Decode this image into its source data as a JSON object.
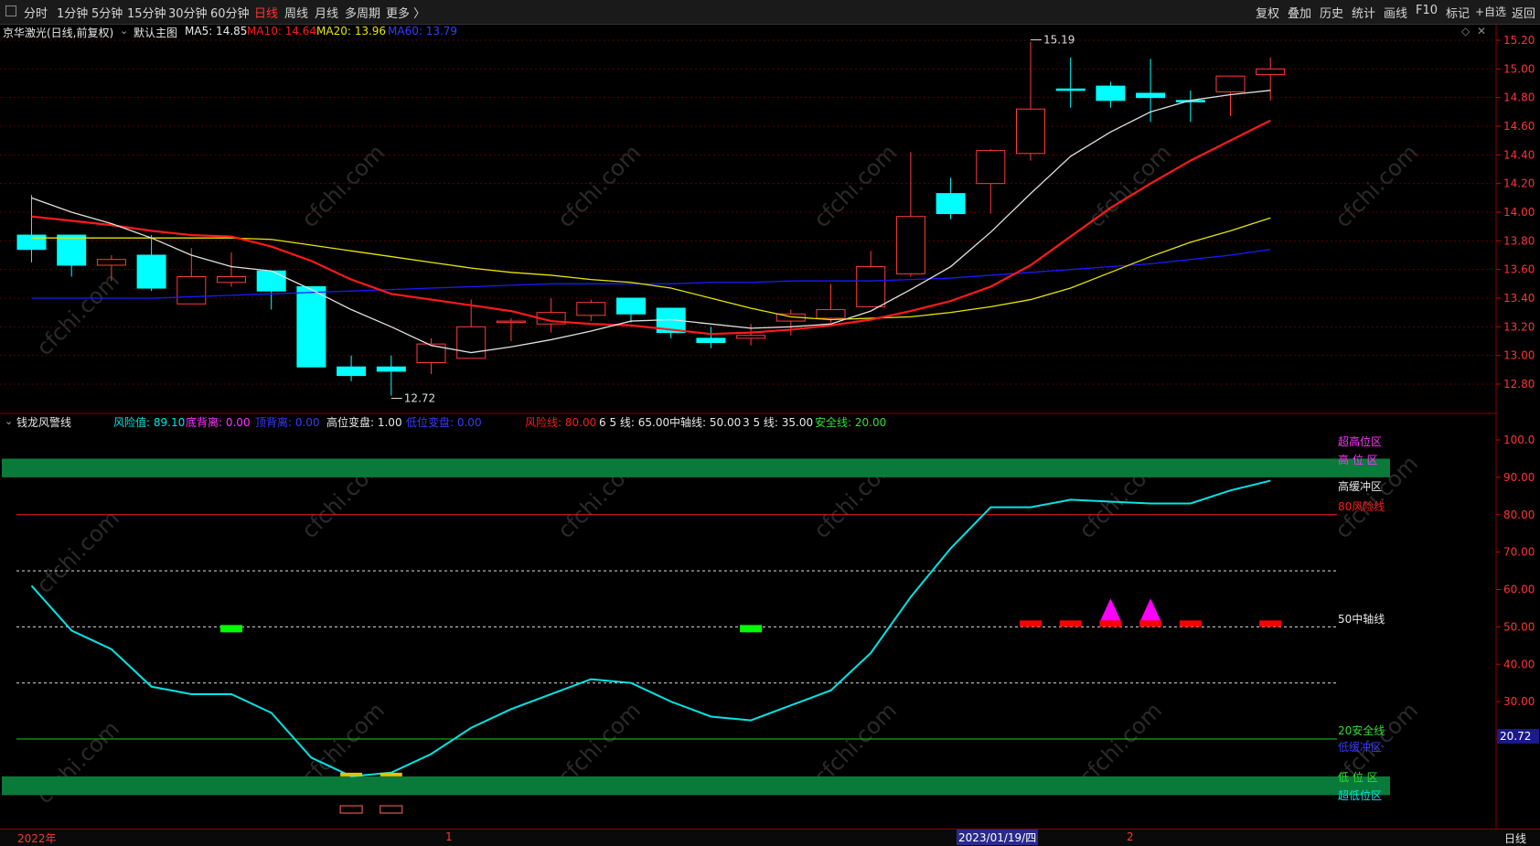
{
  "toolbar": {
    "left": [
      "分时",
      "1分钟",
      "5分钟",
      "15分钟",
      "30分钟",
      "60分钟",
      "日线",
      "周线",
      "月线",
      "多周期",
      "更多 〉"
    ],
    "active": "日线",
    "right": [
      "复权",
      "叠加",
      "历史",
      "统计",
      "画线",
      "F10",
      "+自选",
      "返回"
    ],
    "mark": "标记"
  },
  "main": {
    "stock": "京华激光(日线,前复权)",
    "template": "默认主图",
    "ma5": "MA5: 14.85",
    "ma10": "MA10: 14.64",
    "ma20": "MA20: 13.96",
    "ma60": "MA60: 13.79",
    "high_marker": "15.19",
    "low_marker": "12.72",
    "price_ticks": [
      "15.20",
      "15.00",
      "14.80",
      "14.60",
      "14.40",
      "14.20",
      "14.00",
      "13.80",
      "13.60",
      "13.40",
      "13.20",
      "13.00",
      "12.80"
    ]
  },
  "indicator": {
    "name": "钱龙风警线",
    "fxz": "风险值: 89.10",
    "dbl": "底背离: 0.00",
    "dbl2": "顶背离: 0.00",
    "gwbp": "高位变盘: 1.00",
    "dwbp": "低位变盘: 0.00",
    "fxx": "风险线: 80.00",
    "l65": "6 5 线: 65.00",
    "zzx": "中轴线: 50.00",
    "l35": "3 5 线: 35.00",
    "aqx": "安全线: 20.00",
    "ticks": [
      "100.0",
      "90.00",
      "80.00",
      "70.00",
      "60.00",
      "50.00",
      "40.00",
      "30.00",
      "20.00"
    ],
    "current": "20.72",
    "zones": {
      "super_high": "超高位区",
      "high": "高  位  区",
      "high_buffer": "高缓冲区",
      "risk80": "80风险线",
      "axis50": "50中轴线",
      "safe20": "20安全线",
      "low_buffer": "低缓冲区",
      "low": "低  位  区",
      "super_low": "超低位区"
    }
  },
  "bottom": {
    "year": "2022年",
    "m1": "1",
    "date": "2023/01/19/四",
    "m2": "2",
    "period": "日线"
  },
  "watermark": "cfchi.com",
  "colors": {
    "up": "#ff3b3b",
    "down": "#00ffff",
    "ma5": "#e0e0e0",
    "ma10": "#ff1a1a",
    "ma20": "#e6e600",
    "ma60": "#1a1aff",
    "risk": "#00e5e5",
    "zone": "#0a7a3a"
  }
}
